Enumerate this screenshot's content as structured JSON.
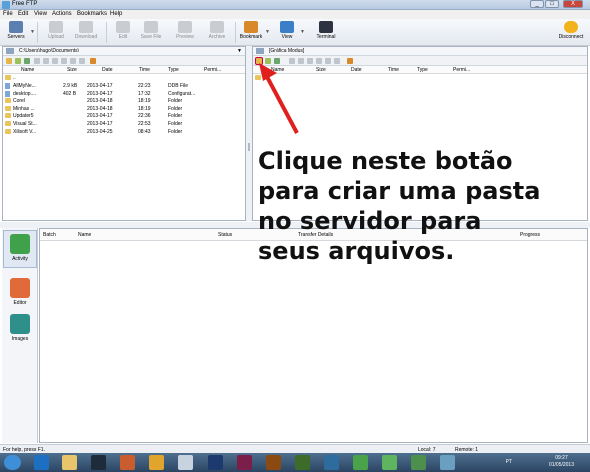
{
  "window": {
    "title": "Free FTP",
    "min": "_",
    "max": "□",
    "close": "X"
  },
  "menu": [
    "File",
    "Edit",
    "View",
    "Actions",
    "Bookmarks",
    "Help"
  ],
  "toolbar": {
    "servers": "Servers",
    "upload": "Upload",
    "download": "Download",
    "edit": "Edit",
    "save_file": "Save File",
    "preview": "Preview",
    "archive": "Archive",
    "bookmark": "Bookmark",
    "view": "View",
    "terminal": "Terminal",
    "disconnect": "Disconnect"
  },
  "local": {
    "path": "C:\\Users\\hugo\\Documents\\",
    "columns": [
      "Name",
      "Size",
      "Date",
      "Time",
      "Type",
      "Permi..."
    ],
    "parent": "..",
    "files": [
      {
        "name": "AllMyNe...",
        "size": "2.9 kB",
        "date": "2013-04-17",
        "time": "22:23",
        "type": "DDB File",
        "kind": "file"
      },
      {
        "name": "desktop....",
        "size": "402 B",
        "date": "2013-04-17",
        "time": "17:32",
        "type": "Configurat...",
        "kind": "file"
      },
      {
        "name": "Corel",
        "size": "",
        "date": "2013-04-18",
        "time": "18:19",
        "type": "Folder",
        "kind": "folder"
      },
      {
        "name": "Minhas ...",
        "size": "",
        "date": "2013-04-18",
        "time": "18:19",
        "type": "Folder",
        "kind": "folder"
      },
      {
        "name": "Updater5",
        "size": "",
        "date": "2013-04-17",
        "time": "22:36",
        "type": "Folder",
        "kind": "folder"
      },
      {
        "name": "Visual St...",
        "size": "",
        "date": "2013-04-17",
        "time": "22:53",
        "type": "Folder",
        "kind": "folder"
      },
      {
        "name": "Xilisoft V...",
        "size": "",
        "date": "2013-04-25",
        "time": "08:43",
        "type": "Folder",
        "kind": "folder"
      }
    ]
  },
  "remote": {
    "path": "[Gráfica Modus]",
    "columns": [
      "Name",
      "Size",
      "Date",
      "Time",
      "Type",
      "Permi..."
    ],
    "parent": ".."
  },
  "activity": {
    "nav": [
      "Activity",
      "Editor",
      "Images"
    ],
    "columns": [
      "Batch",
      "Name",
      "Status",
      "Transfer Details",
      "Progress"
    ]
  },
  "status": {
    "help": "For help, press F1.",
    "local": "Local: 7",
    "remote": "Remote: 1"
  },
  "taskbar": {
    "lang": "PT",
    "time": "09:27",
    "date": "01/05/2013"
  },
  "annotation": {
    "line1": "Clique neste botão",
    "line2": "para criar uma pasta",
    "line3": "no servidor para",
    "line4": "seus arquivos."
  },
  "colors": {
    "arrow": "#e0201f",
    "accent": "#2e6db5"
  }
}
